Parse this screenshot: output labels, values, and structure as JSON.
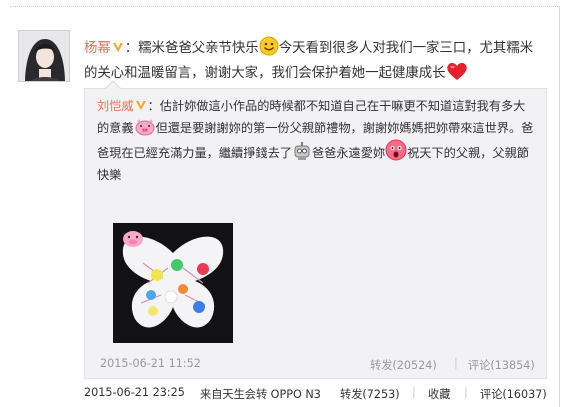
{
  "post": {
    "author": "杨幂",
    "colon": "：",
    "text_part1": "糯米爸爸父亲节快乐",
    "text_part2": "今天看到很多人对我们一家三口，尤其糯米的关心和温暖留言，谢谢大家，我们会保护着她一起健康成长",
    "timestamp": "2015-06-21 23:25",
    "source": "来自天生会转 OPPO N3",
    "forward": "转发(7253)",
    "separator": "|",
    "favorite": "收藏",
    "comment": "评论(16037)"
  },
  "retweet": {
    "author": "刘恺威",
    "colon": "：",
    "text_part1": "估計妳做這小作品的時候都不知道自己在干嘛更不知道這對我有多大的意義",
    "text_part2": "但還是要謝謝妳的第一份父親節禮物，謝謝妳媽媽把妳帶來這世界。爸爸現在已經充滿力量，繼續掙錢去了",
    "text_part3": "爸爸永遠愛妳",
    "text_part4": "祝天下的父親，父親節快樂",
    "timestamp": "2015-06-21 11:52",
    "forward": "转发(20524)",
    "separator": "|",
    "comment": "评论(13854)"
  },
  "icons": {
    "avatar": "avatar-photo",
    "verified": "verified-v-icon",
    "smile": "smile-emoji-icon",
    "heart": "heart-emoji-icon",
    "pig": "pig-emoji-icon",
    "robot": "robot-emoji-icon",
    "surprise": "surprised-emoji-icon"
  },
  "colors": {
    "author_link": "#eb7350",
    "meta_gray": "#999999",
    "retweet_bg": "#f2f2f5",
    "verified_badge": "#f5a623"
  }
}
